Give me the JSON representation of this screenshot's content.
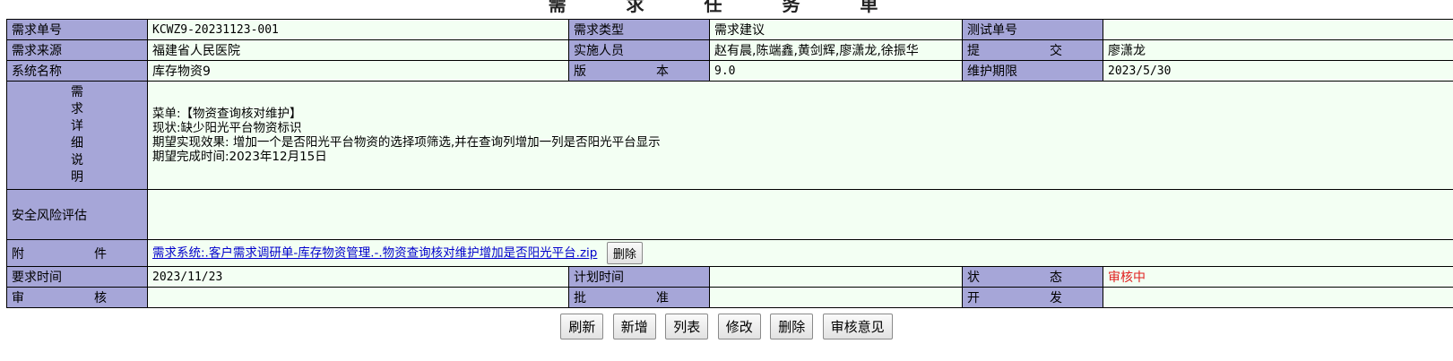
{
  "page_title": "需 求 任 务 单",
  "rows": {
    "req_no_label": "需求单号",
    "req_no_value": "KCWZ9-20231123-001",
    "req_type_label": "需求类型",
    "req_type_value": "需求建议",
    "test_no_label": "测试单号",
    "test_no_value": "",
    "source_label": "需求来源",
    "source_value": "福建省人民医院",
    "implementer_label": "实施人员",
    "implementer_value": "赵有晨,陈端鑫,黄剑辉,廖潇龙,徐振华",
    "submit_label_a": "提",
    "submit_label_b": "交",
    "submit_value": "廖潇龙",
    "system_label": "系统名称",
    "system_value": "库存物资9",
    "version_label_a": "版",
    "version_label_b": "本",
    "version_value": "9.0",
    "maintain_label": "维护期限",
    "maintain_value": "2023/5/30",
    "detail_label_chars": [
      "需",
      "求",
      "详",
      "细",
      "说",
      "明"
    ],
    "detail_lines": [
      "菜单:【物资查询核对维护】",
      "现状:缺少阳光平台物资标识",
      "期望实现效果: 增加一个是否阳光平台物资的选择项筛选,并在查询列增加一列是否阳光平台显示",
      "期望完成时间:2023年12月15日"
    ],
    "risk_label": "安全风险评估",
    "risk_value": "",
    "attach_label_a": "附",
    "attach_label_b": "件",
    "attach_link": "需求系统:.客户需求调研单-库存物资管理.-.物资查询核对维护增加是否阳光平台.zip",
    "attach_delete": "删除",
    "req_time_label": "要求时间",
    "req_time_value": "2023/11/23",
    "plan_time_label": "计划时间",
    "plan_time_value": "",
    "status_label_a": "状",
    "status_label_b": "态",
    "status_value": "审核中",
    "audit_label_a": "审",
    "audit_label_b": "核",
    "audit_value": "",
    "approve_label_a": "批",
    "approve_label_b": "准",
    "approve_value": "",
    "dev_label_a": "开",
    "dev_label_b": "发",
    "dev_value": ""
  },
  "buttons": {
    "refresh": "刷新",
    "add": "新增",
    "list": "列表",
    "edit": "修改",
    "delete": "删除",
    "review": "审核意见"
  },
  "colors": {
    "label_bg": "#a6a6d8",
    "value_bg": "#f3fff3",
    "status": "#e02020",
    "link": "#0000cc"
  }
}
